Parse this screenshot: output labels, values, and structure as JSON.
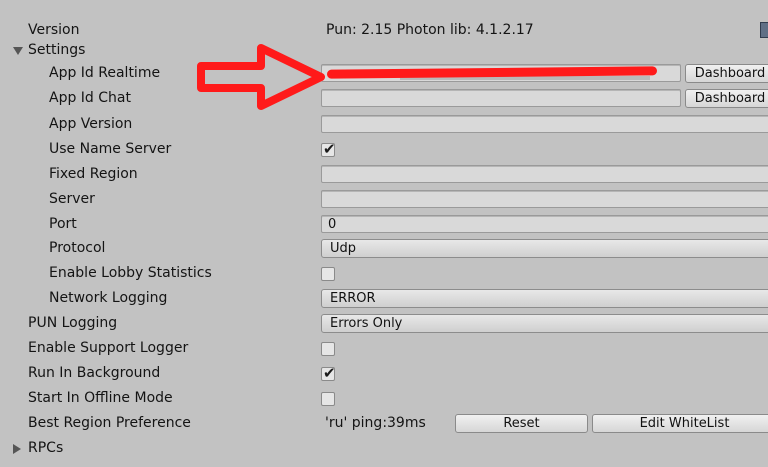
{
  "inspector": {
    "version": {
      "label": "Version",
      "value": "Pun: 2.15 Photon lib: 4.1.2.17"
    },
    "settings": {
      "label": "Settings",
      "app_id_realtime": {
        "label": "App Id Realtime",
        "button": "Dashboard"
      },
      "app_id_chat": {
        "label": "App Id Chat",
        "value": "",
        "button": "Dashboard"
      },
      "app_version": {
        "label": "App Version",
        "value": ""
      },
      "use_name_server": {
        "label": "Use Name Server",
        "checked": true
      },
      "fixed_region": {
        "label": "Fixed Region",
        "value": ""
      },
      "server": {
        "label": "Server",
        "value": ""
      },
      "port": {
        "label": "Port",
        "value": "0"
      },
      "protocol": {
        "label": "Protocol",
        "value": "Udp"
      },
      "enable_lobby_statistics": {
        "label": "Enable Lobby Statistics",
        "checked": false
      },
      "network_logging": {
        "label": "Network Logging",
        "value": "ERROR"
      }
    },
    "pun_logging": {
      "label": "PUN Logging",
      "value": "Errors Only"
    },
    "enable_support_logger": {
      "label": "Enable Support Logger",
      "checked": false
    },
    "run_in_background": {
      "label": "Run In Background",
      "checked": true
    },
    "start_in_offline_mode": {
      "label": "Start In Offline Mode",
      "checked": false
    },
    "best_region_preference": {
      "label": "Best Region Preference",
      "value": "'ru' ping:39ms",
      "reset_button": "Reset",
      "edit_whitelist_button": "Edit WhiteList"
    },
    "rpcs": {
      "label": "RPCs"
    }
  },
  "colors": {
    "background": "#c2c2c2",
    "annotation_red": "#ff1a1a"
  },
  "icons": {
    "checkmark": "✔",
    "foldout_open": "triangle-down",
    "foldout_closed": "triangle-right"
  }
}
